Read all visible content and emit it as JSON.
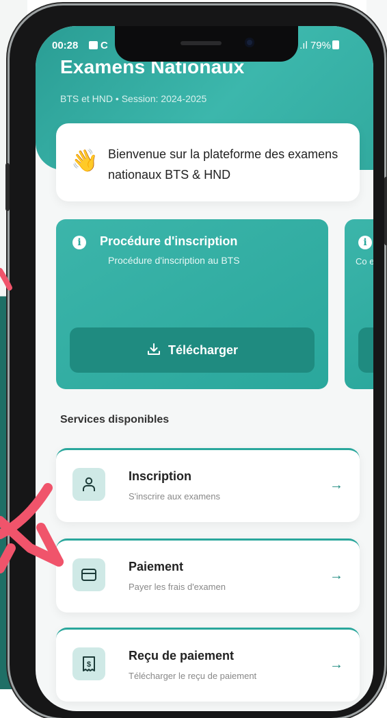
{
  "status_bar": {
    "time": "00:28",
    "extra_icon_letter": "C",
    "signal": "ıl .ıl",
    "battery": "79%"
  },
  "header": {
    "title": "Examens Nationaux",
    "subtitle": "BTS et HND • Session: 2024-2025"
  },
  "welcome": {
    "emoji": "👋",
    "text": "Bienvenue sur la plateforme des examens nationaux BTS & HND"
  },
  "procedure_card": {
    "title": "Procédure d'inscription",
    "subtitle": "Procédure d'inscription au BTS",
    "button_label": "Télécharger"
  },
  "next_card": {
    "partial_text": "Co exa"
  },
  "services": {
    "title": "Services disponibles",
    "items": [
      {
        "title": "Inscription",
        "subtitle": "S'inscrire aux examens",
        "icon": "user-icon"
      },
      {
        "title": "Paiement",
        "subtitle": "Payer les frais d'examen",
        "icon": "card-icon"
      },
      {
        "title": "Reçu de paiement",
        "subtitle": "Télécharger le reçu de paiement",
        "icon": "receipt-icon"
      }
    ]
  },
  "colors": {
    "primary": "#2aa79c",
    "primary_dark": "#1f8b80",
    "icon_bg": "#cfe9e6",
    "annotation_arrow": "#f0546b"
  }
}
